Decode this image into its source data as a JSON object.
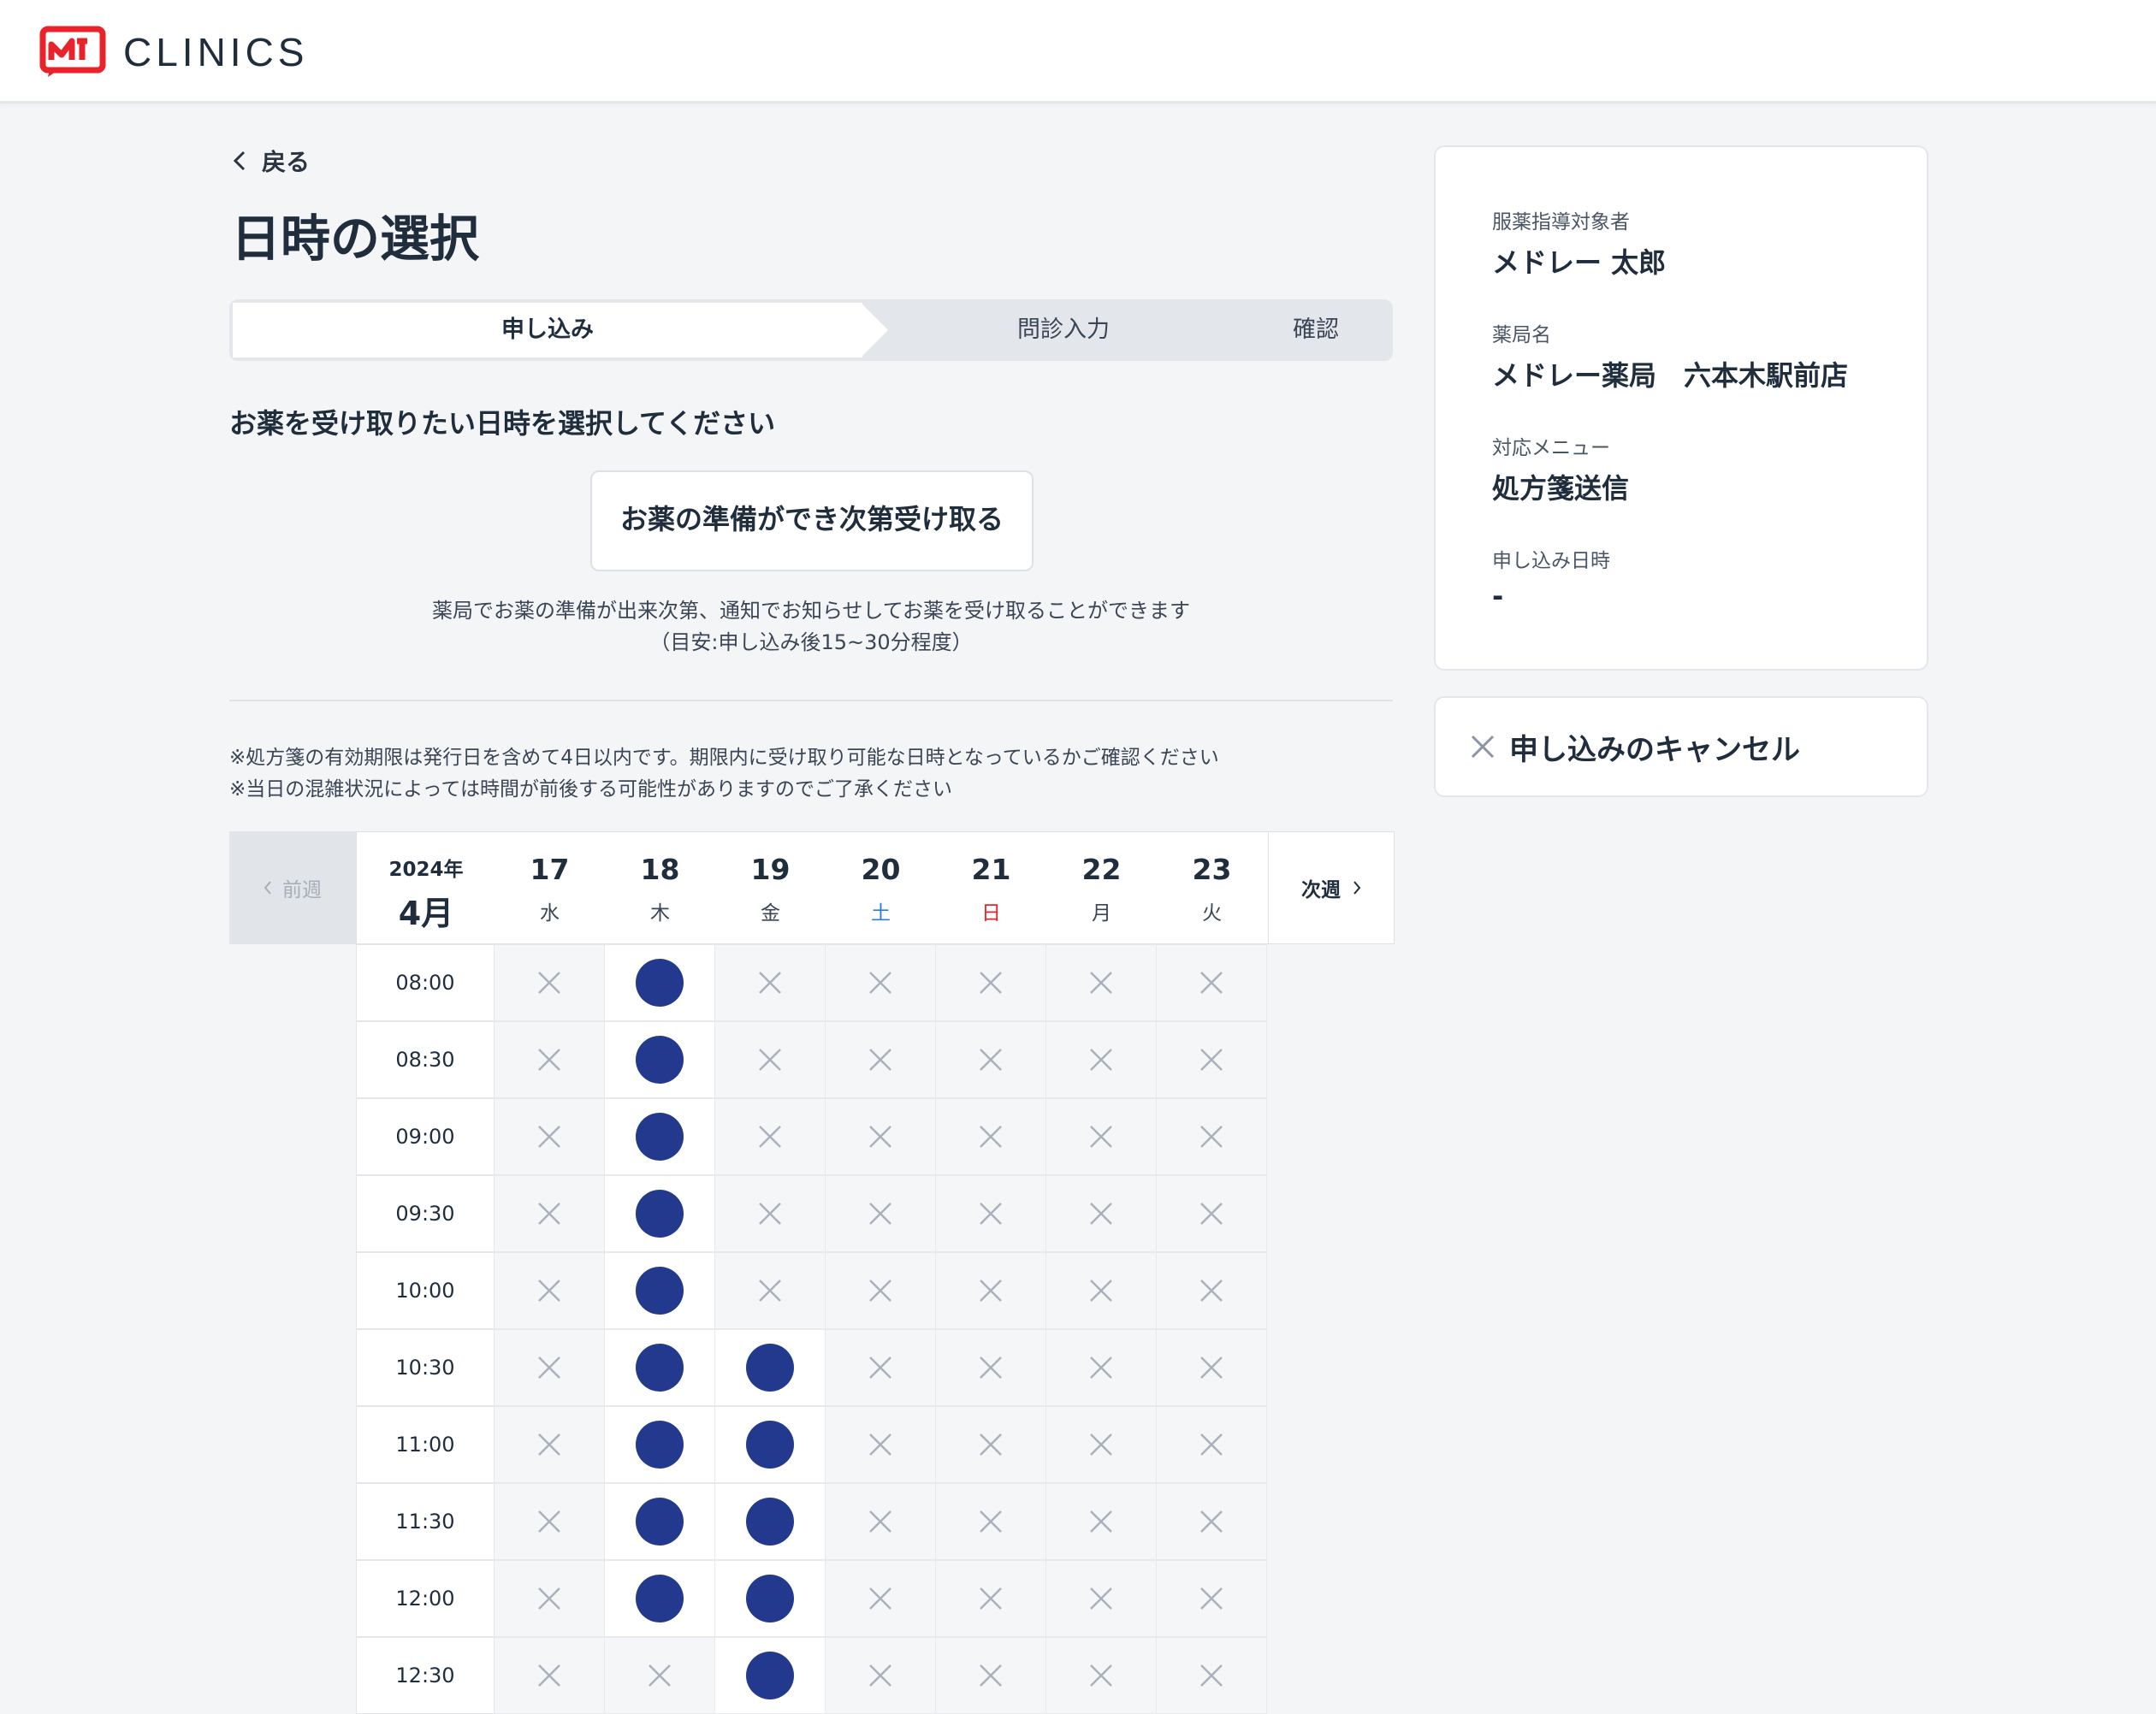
{
  "brand": {
    "name": "CLINICS",
    "logo_color": "#e8232a"
  },
  "nav": {
    "back_label": "戻る"
  },
  "page": {
    "title": "日時の選択"
  },
  "steps": [
    {
      "label": "申し込み",
      "active": true
    },
    {
      "label": "問診入力",
      "active": false
    },
    {
      "label": "確認",
      "active": false
    }
  ],
  "instruction": "お薬を受け取りたい日時を選択してください",
  "asap": {
    "button_label": "お薬の準備ができ次第受け取る",
    "desc_line1": "薬局でお薬の準備が出来次第、通知でお知らせしてお薬を受け取ることができます",
    "desc_line2": "（目安:申し込み後15~30分程度）"
  },
  "notes": [
    "※処方箋の有効期限は発行日を含めて4日以内です。期限内に受け取り可能な日時となっているかご確認ください",
    "※当日の混雑状況によっては時間が前後する可能性がありますのでご了承ください"
  ],
  "calendar": {
    "prev_label": "前週",
    "next_label": "次週",
    "year": "2024年",
    "month": "4月",
    "days": [
      {
        "num": "17",
        "weekday": "水",
        "color": "#3a4555"
      },
      {
        "num": "18",
        "weekday": "木",
        "color": "#3a4555"
      },
      {
        "num": "19",
        "weekday": "金",
        "color": "#3a4555"
      },
      {
        "num": "20",
        "weekday": "土",
        "color": "#2f7bd8"
      },
      {
        "num": "21",
        "weekday": "日",
        "color": "#e8232a"
      },
      {
        "num": "22",
        "weekday": "月",
        "color": "#3a4555"
      },
      {
        "num": "23",
        "weekday": "火",
        "color": "#3a4555"
      }
    ],
    "available_color": "#22398d",
    "slots": [
      {
        "time": "08:00",
        "available": [
          false,
          true,
          false,
          false,
          false,
          false,
          false
        ]
      },
      {
        "time": "08:30",
        "available": [
          false,
          true,
          false,
          false,
          false,
          false,
          false
        ]
      },
      {
        "time": "09:00",
        "available": [
          false,
          true,
          false,
          false,
          false,
          false,
          false
        ]
      },
      {
        "time": "09:30",
        "available": [
          false,
          true,
          false,
          false,
          false,
          false,
          false
        ]
      },
      {
        "time": "10:00",
        "available": [
          false,
          true,
          false,
          false,
          false,
          false,
          false
        ]
      },
      {
        "time": "10:30",
        "available": [
          false,
          true,
          true,
          false,
          false,
          false,
          false
        ]
      },
      {
        "time": "11:00",
        "available": [
          false,
          true,
          true,
          false,
          false,
          false,
          false
        ]
      },
      {
        "time": "11:30",
        "available": [
          false,
          true,
          true,
          false,
          false,
          false,
          false
        ]
      },
      {
        "time": "12:00",
        "available": [
          false,
          true,
          true,
          false,
          false,
          false,
          false
        ]
      },
      {
        "time": "12:30",
        "available": [
          false,
          false,
          true,
          false,
          false,
          false,
          false
        ]
      }
    ]
  },
  "summary": {
    "patient_label": "服薬指導対象者",
    "patient_value": "メドレー 太郎",
    "pharmacy_label": "薬局名",
    "pharmacy_value": "メドレー薬局　六本木駅前店",
    "menu_label": "対応メニュー",
    "menu_value": "処方箋送信",
    "datetime_label": "申し込み日時",
    "datetime_value": "-"
  },
  "cancel": {
    "label": "申し込みのキャンセル"
  }
}
